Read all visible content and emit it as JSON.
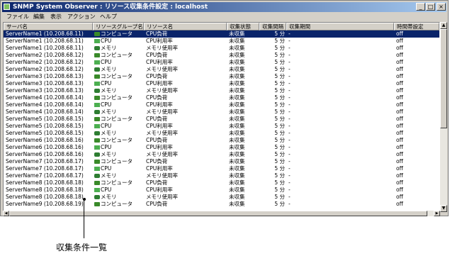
{
  "window": {
    "title": "SNMP System Observer : リソース収集条件設定 : localhost",
    "controls": {
      "minimize": "_",
      "maximize": "□",
      "close": "×"
    }
  },
  "menu": [
    "ファイル",
    "編集",
    "表示",
    "アクション",
    "ヘルプ"
  ],
  "columns": [
    "サーバ名",
    "リソースグループ名",
    "リソース名",
    "収集状態",
    "収集間隔",
    "収集期間",
    "時間帯設定"
  ],
  "rows": [
    {
      "server": "ServerName1 (10.208.68.11)",
      "group": "コンピュータ",
      "group_icon": "computer-icon",
      "resource": "CPU負荷",
      "state": "未収集",
      "interval": "5 分",
      "period": "-",
      "timeband": "off"
    },
    {
      "server": "ServerName1 (10.208.68.11)",
      "group": "CPU",
      "group_icon": "cpu-icon",
      "resource": "CPU利用率",
      "state": "未収集",
      "interval": "5 分",
      "period": "-",
      "timeband": "off"
    },
    {
      "server": "ServerName1 (10.208.68.11)",
      "group": "メモリ",
      "group_icon": "memory-icon",
      "resource": "メモリ使用率",
      "state": "未収集",
      "interval": "5 分",
      "period": "-",
      "timeband": "off"
    },
    {
      "server": "ServerName2 (10.208.68.12)",
      "group": "コンピュータ",
      "group_icon": "computer-icon",
      "resource": "CPU負荷",
      "state": "未収集",
      "interval": "5 分",
      "period": "-",
      "timeband": "off"
    },
    {
      "server": "ServerName2 (10.208.68.12)",
      "group": "CPU",
      "group_icon": "cpu-icon",
      "resource": "CPU利用率",
      "state": "未収集",
      "interval": "5 分",
      "period": "-",
      "timeband": "off"
    },
    {
      "server": "ServerName2 (10.208.68.12)",
      "group": "メモリ",
      "group_icon": "memory-icon",
      "resource": "メモリ使用率",
      "state": "未収集",
      "interval": "5 分",
      "period": "-",
      "timeband": "off"
    },
    {
      "server": "ServerName3 (10.208.68.13)",
      "group": "コンピュータ",
      "group_icon": "computer-icon",
      "resource": "CPU負荷",
      "state": "未収集",
      "interval": "5 分",
      "period": "-",
      "timeband": "off"
    },
    {
      "server": "ServerName3 (10.208.68.13)",
      "group": "CPU",
      "group_icon": "cpu-icon",
      "resource": "CPU利用率",
      "state": "未収集",
      "interval": "5 分",
      "period": "-",
      "timeband": "off"
    },
    {
      "server": "ServerName3 (10.208.68.13)",
      "group": "メモリ",
      "group_icon": "memory-icon",
      "resource": "メモリ使用率",
      "state": "未収集",
      "interval": "5 分",
      "period": "-",
      "timeband": "off"
    },
    {
      "server": "ServerName4 (10.208.68.14)",
      "group": "コンピュータ",
      "group_icon": "computer-icon",
      "resource": "CPU負荷",
      "state": "未収集",
      "interval": "5 分",
      "period": "-",
      "timeband": "off"
    },
    {
      "server": "ServerName4 (10.208.68.14)",
      "group": "CPU",
      "group_icon": "cpu-icon",
      "resource": "CPU利用率",
      "state": "未収集",
      "interval": "5 分",
      "period": "-",
      "timeband": "off"
    },
    {
      "server": "ServerName4 (10.208.68.14)",
      "group": "メモリ",
      "group_icon": "memory-icon",
      "resource": "メモリ使用率",
      "state": "未収集",
      "interval": "5 分",
      "period": "-",
      "timeband": "off"
    },
    {
      "server": "ServerName5 (10.208.68.15)",
      "group": "コンピュータ",
      "group_icon": "computer-icon",
      "resource": "CPU負荷",
      "state": "未収集",
      "interval": "5 分",
      "period": "-",
      "timeband": "off"
    },
    {
      "server": "ServerName5 (10.208.68.15)",
      "group": "CPU",
      "group_icon": "cpu-icon",
      "resource": "CPU利用率",
      "state": "未収集",
      "interval": "5 分",
      "period": "-",
      "timeband": "off"
    },
    {
      "server": "ServerName5 (10.208.68.15)",
      "group": "メモリ",
      "group_icon": "memory-icon",
      "resource": "メモリ使用率",
      "state": "未収集",
      "interval": "5 分",
      "period": "-",
      "timeband": "off"
    },
    {
      "server": "ServerName6 (10.208.68.16)",
      "group": "コンピュータ",
      "group_icon": "computer-icon",
      "resource": "CPU負荷",
      "state": "未収集",
      "interval": "5 分",
      "period": "-",
      "timeband": "off"
    },
    {
      "server": "ServerName6 (10.208.68.16)",
      "group": "CPU",
      "group_icon": "cpu-icon",
      "resource": "CPU利用率",
      "state": "未収集",
      "interval": "5 分",
      "period": "-",
      "timeband": "off"
    },
    {
      "server": "ServerName6 (10.208.68.16)",
      "group": "メモリ",
      "group_icon": "memory-icon",
      "resource": "メモリ使用率",
      "state": "未収集",
      "interval": "5 分",
      "period": "-",
      "timeband": "off"
    },
    {
      "server": "ServerName7 (10.208.68.17)",
      "group": "コンピュータ",
      "group_icon": "computer-icon",
      "resource": "CPU負荷",
      "state": "未収集",
      "interval": "5 分",
      "period": "-",
      "timeband": "off"
    },
    {
      "server": "ServerName7 (10.208.68.17)",
      "group": "CPU",
      "group_icon": "cpu-icon",
      "resource": "CPU利用率",
      "state": "未収集",
      "interval": "5 分",
      "period": "-",
      "timeband": "off"
    },
    {
      "server": "ServerName7 (10.208.68.17)",
      "group": "メモリ",
      "group_icon": "memory-icon",
      "resource": "メモリ使用率",
      "state": "未収集",
      "interval": "5 分",
      "period": "-",
      "timeband": "off"
    },
    {
      "server": "ServerName8 (10.208.68.18)",
      "group": "コンピュータ",
      "group_icon": "computer-icon",
      "resource": "CPU負荷",
      "state": "未収集",
      "interval": "5 分",
      "period": "-",
      "timeband": "off"
    },
    {
      "server": "ServerName8 (10.208.68.18)",
      "group": "CPU",
      "group_icon": "cpu-icon",
      "resource": "CPU利用率",
      "state": "未収集",
      "interval": "5 分",
      "period": "-",
      "timeband": "off"
    },
    {
      "server": "ServerName8 (10.208.68.18)",
      "group": "メモリ",
      "group_icon": "memory-icon",
      "resource": "メモリ使用率",
      "state": "未収集",
      "interval": "5 分",
      "period": "-",
      "timeband": "off"
    },
    {
      "server": "ServerName9 (10.208.68.19)",
      "group": "コンピュータ",
      "group_icon": "computer-icon",
      "resource": "CPU負荷",
      "state": "未収集",
      "interval": "5 分",
      "period": "-",
      "timeband": "off"
    }
  ],
  "selected_row": 0,
  "callout": "収集条件一覧",
  "colors": {
    "selection": "#0a246a",
    "title_start": "#0a246a",
    "title_end": "#a6caf0",
    "chrome": "#d4d0c8",
    "icon_green": "#3a8a2a"
  }
}
